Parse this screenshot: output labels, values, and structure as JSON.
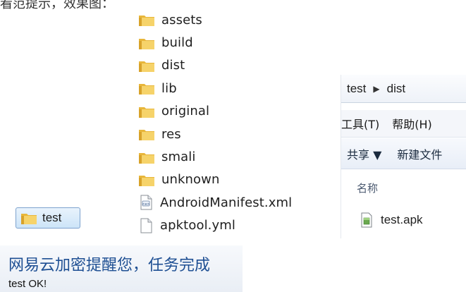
{
  "header_fragment": "看范提示，效果图：",
  "file_list": [
    {
      "name": "assets",
      "type": "folder"
    },
    {
      "name": "build",
      "type": "folder"
    },
    {
      "name": "dist",
      "type": "folder"
    },
    {
      "name": "lib",
      "type": "folder"
    },
    {
      "name": "original",
      "type": "folder"
    },
    {
      "name": "res",
      "type": "folder"
    },
    {
      "name": "smali",
      "type": "folder"
    },
    {
      "name": "unknown",
      "type": "folder"
    },
    {
      "name": "AndroidManifest.xml",
      "type": "xml"
    },
    {
      "name": "apktool.yml",
      "type": "file"
    }
  ],
  "explorer": {
    "breadcrumb": [
      "test",
      "dist"
    ],
    "menu": [
      "工具(T)",
      "帮助(H)"
    ],
    "toolbar": {
      "share": "共享 ▼",
      "new_folder": "新建文件"
    },
    "column_name": "名称",
    "files": [
      {
        "name": "test.apk"
      }
    ]
  },
  "selected_folder": "test",
  "notification": {
    "title": "网易云加密提醒您，任务完成",
    "message": "test OK!"
  },
  "colors": {
    "folder": "#f2c94c",
    "selection": "#cde4f8",
    "notify_title": "#1e4f93"
  }
}
